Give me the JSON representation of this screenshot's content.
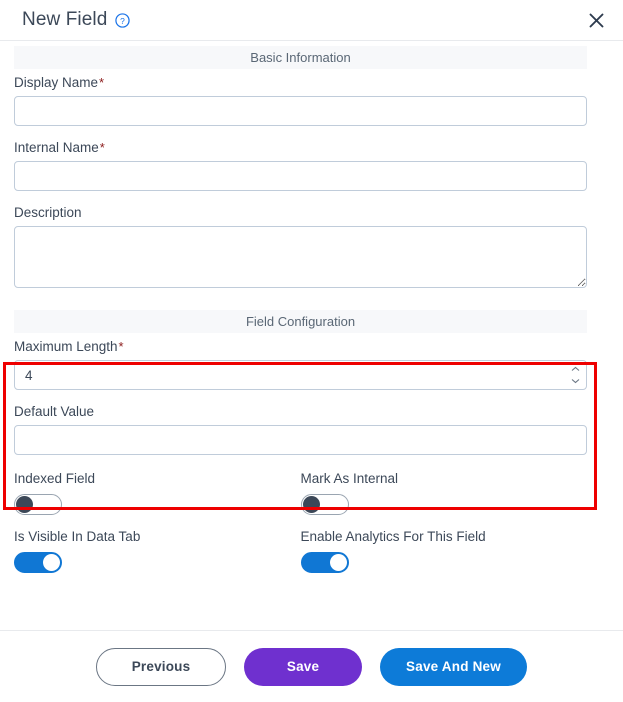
{
  "header": {
    "title": "New Field",
    "help_icon": "help-circle-icon",
    "close_icon": "close-icon"
  },
  "sections": {
    "basic_information": "Basic Information",
    "field_configuration": "Field Configuration"
  },
  "fields": {
    "display_name": {
      "label": "Display Name",
      "required_marker": "*",
      "value": "",
      "placeholder": ""
    },
    "internal_name": {
      "label": "Internal Name",
      "required_marker": "*",
      "value": "",
      "placeholder": ""
    },
    "description": {
      "label": "Description",
      "value": "",
      "placeholder": ""
    },
    "maximum_length": {
      "label": "Maximum Length",
      "required_marker": "*",
      "value": "4",
      "placeholder": ""
    },
    "default_value": {
      "label": "Default Value",
      "value": "",
      "placeholder": ""
    }
  },
  "toggles": [
    {
      "label": "Indexed Field",
      "state": "off"
    },
    {
      "label": "Mark As Internal",
      "state": "off"
    },
    {
      "label": "Is Visible In Data Tab",
      "state": "on"
    },
    {
      "label": "Enable Analytics For This Field",
      "state": "on"
    }
  ],
  "footer": {
    "previous_label": "Previous",
    "save_label": "Save",
    "save_and_new_label": "Save And New"
  },
  "colors": {
    "accent_blue": "#0d7bd8",
    "accent_purple": "#6f30cf",
    "toggle_on": "#1077d4",
    "toggle_off_knob": "#3c4858",
    "highlight_red": "#ee0000",
    "required_red": "#8b1a1a",
    "section_bar_bg": "#f7f8fa",
    "input_border": "#c0ccda",
    "text": "#3c4858"
  }
}
